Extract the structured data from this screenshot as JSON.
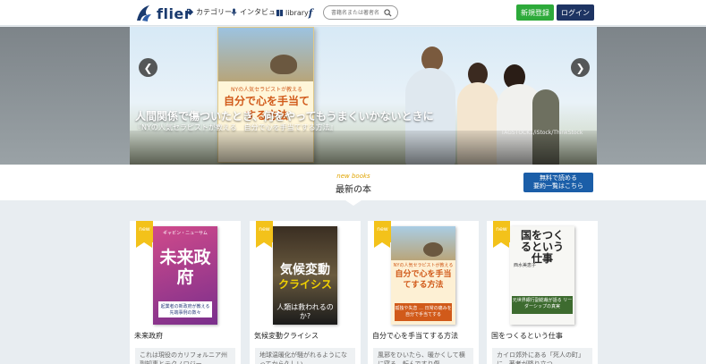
{
  "header": {
    "logo_text": "flier",
    "nav_category": "カテゴリー",
    "nav_interview": "インタビュー",
    "nav_library": "library",
    "nav_library_f": "f",
    "search_placeholder": "書籍名または著者名",
    "signup_label": "新規登録",
    "login_label": "ログイン",
    "brand_color": "#1e3463",
    "signup_color": "#2daa3a"
  },
  "hero": {
    "title": "人間関係で傷ついたとき、何をやってもうまくいかないときに",
    "subtitle": "『NYの人気セラピストが教える　自分で心を手当てする方法』",
    "credit": "TAGSTOCK1/iStock/ThinkStock",
    "book_sub": "NYの人気セラピストが教える",
    "book_title": "自分で心を手当てする方法",
    "prev_arrow": "❮",
    "next_arrow": "❯"
  },
  "section": {
    "label_en": "new books",
    "label_ja": "最新の本",
    "free_line1": "無料で読める",
    "free_line2": "要約一覧はこちら"
  },
  "books": [
    {
      "badge": "new",
      "title": "未来政府",
      "excerpt": "これは現役のカリフォルニア州副知事とテクノロジー",
      "cover_title": "未来政府",
      "cover_top": "ギャビン・ニューサム",
      "cover_band": "起業者の新政府が教える 先端事例の数々"
    },
    {
      "badge": "new",
      "title": "気候変動クライシス",
      "excerpt": "地球温暖化が騒がれるようになってから久しい",
      "cover_title1": "気候変動",
      "cover_title2": "クライシス",
      "cover_question": "人類は救われるのか?"
    },
    {
      "badge": "new",
      "title": "自分で心を手当てする方法",
      "excerpt": "風邪をひいたら、暖かくして横に寝る。転んですり傷",
      "cover_sub": "NYの人気セラピストが教える",
      "cover_title": "自分で心を手当てする方法",
      "cover_band": "孤独や失恋 … 日常の痛みを自分で手当てする"
    },
    {
      "badge": "new",
      "title": "国をつくるという仕事",
      "excerpt": "カイロ郊外にある「死人の町」に、著者が降り立つ",
      "cover_title": "国をつくるという仕事",
      "cover_author": "西水美恵子",
      "cover_band": "元世界銀行副総裁が語る リーダーシップの真実"
    }
  ]
}
